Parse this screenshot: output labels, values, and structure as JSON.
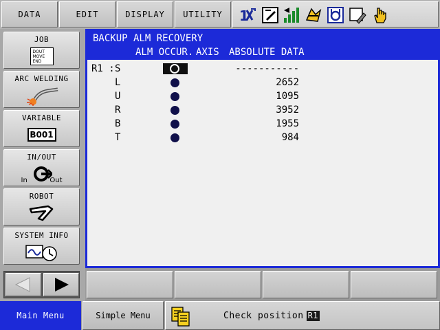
{
  "top_menu": {
    "data_label": "DATA",
    "edit_label": "EDIT",
    "display_label": "DISPLAY",
    "utility_label": "UTILITY"
  },
  "status_icons": [
    "axis-group-icon",
    "edit-mode-icon",
    "signal-level-icon",
    "cycle-mode-icon",
    "teach-mode-icon",
    "edit-lock-icon",
    "hand-pointer-icon"
  ],
  "left_menu": {
    "job_label": "JOB",
    "job_icon_text": [
      "DOUT",
      "MOVE",
      "END"
    ],
    "arc_welding_label": "ARC WELDING",
    "variable_label": "VARIABLE",
    "variable_icon_text": "B001",
    "inout_label": "IN/OUT",
    "inout_in": "In",
    "inout_out": "Out",
    "robot_label": "ROBOT",
    "system_info_label": "SYSTEM INFO"
  },
  "screen": {
    "title": "BACKUP ALM RECOVERY",
    "col_alm": "ALM OCCUR.",
    "col_axis": "AXIS",
    "col_abs": "ABSOLUTE DATA",
    "group_label": "R1 :"
  },
  "rows": [
    {
      "axis": "S",
      "absolute": "-----------",
      "selected": true
    },
    {
      "axis": "L",
      "absolute": "2652",
      "selected": false
    },
    {
      "axis": "U",
      "absolute": "1095",
      "selected": false
    },
    {
      "axis": "R",
      "absolute": "3952",
      "selected": false
    },
    {
      "axis": "B",
      "absolute": "1955",
      "selected": false
    },
    {
      "axis": "T",
      "absolute": "984",
      "selected": false
    }
  ],
  "bottom": {
    "main_menu_label": "Main Menu",
    "simple_menu_label": "Simple Menu",
    "message": "Check position",
    "message_tag": "R1"
  },
  "colors": {
    "accent_blue": "#1c2ad8",
    "dot_navy": "#10104a",
    "panel_bg": "#f0f0f0"
  }
}
